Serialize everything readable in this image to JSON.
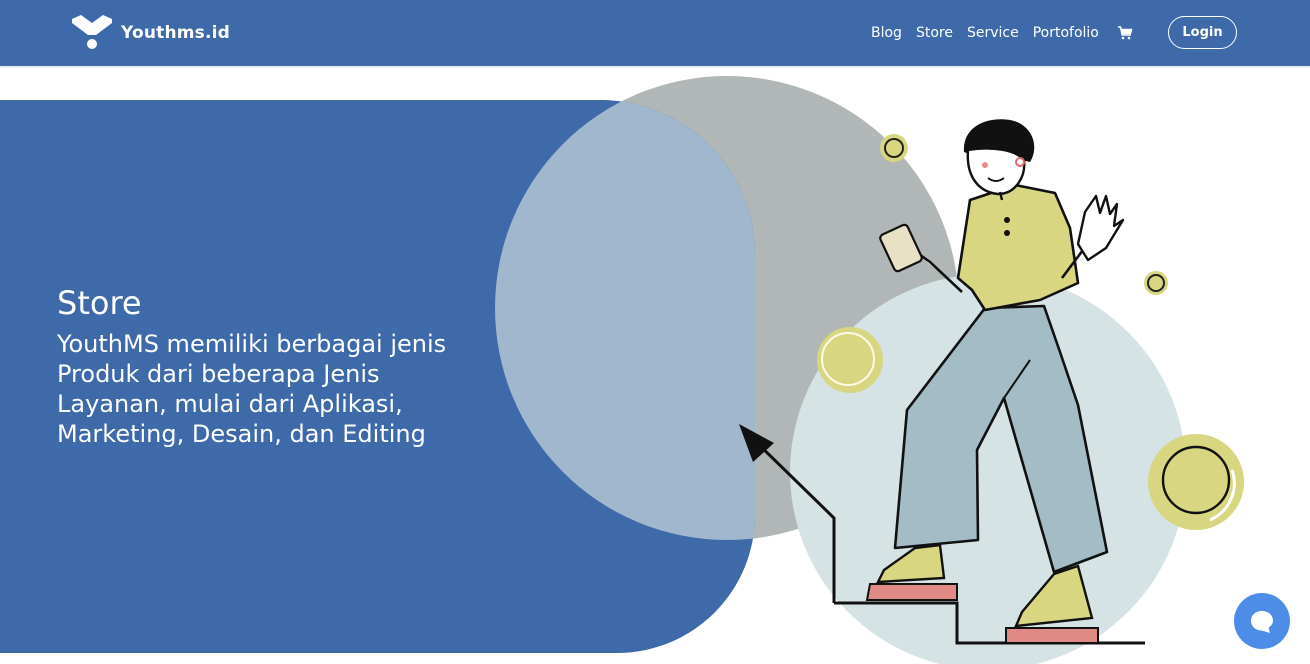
{
  "brand": {
    "name": "Youthms.id",
    "logo_icon": "youthms-logo-icon"
  },
  "nav": {
    "links": [
      "Blog",
      "Store",
      "Service",
      "Portofolio"
    ],
    "cart_icon": "cart-icon",
    "login_label": "Login"
  },
  "hero": {
    "title": "Store",
    "description": "YouthMS memiliki berbagai jenis Produk dari beberapa Jenis Layanan, mulai dari Aplikasi, Marketing, Desain, dan Editing"
  },
  "chat": {
    "icon": "chat-bubble-icon"
  },
  "colors": {
    "primary": "#3e6aaa",
    "gray_circle": "#b0b7b6",
    "light_circle": "#d6e3e4",
    "overlap": "#a0b7cd",
    "yellow": "#d8d681",
    "pants": "#a4bcc6",
    "shoes": "#e08a85",
    "chat": "#4d8de8"
  }
}
